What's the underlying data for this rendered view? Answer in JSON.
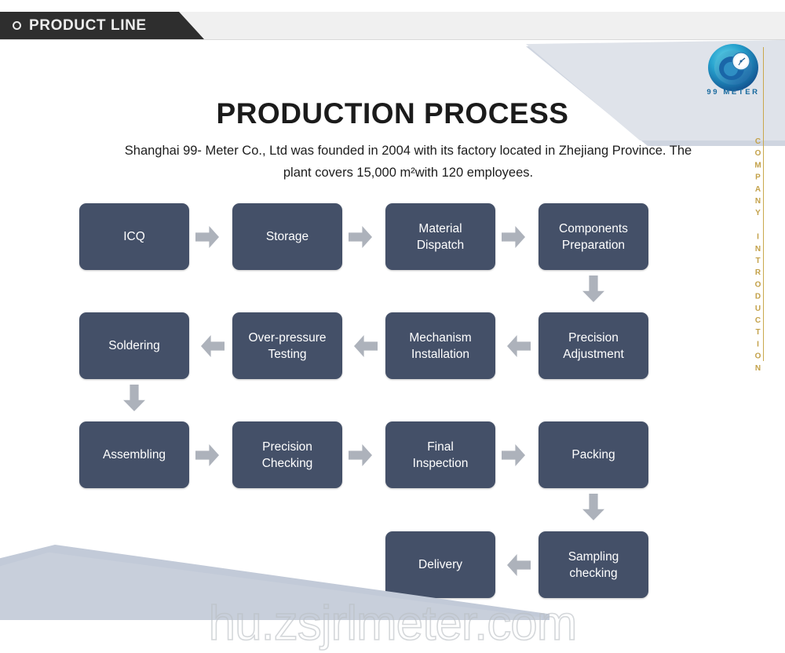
{
  "header": {
    "tag_label": "PRODUCT LINE",
    "bullet_icon": "circle-outline-icon",
    "band_color": "#f0f0f0",
    "tag_color": "#2e2e2e"
  },
  "brand": {
    "logo_icon": "99-meter-spiral-gauge-logo",
    "logo_text": "99 METER",
    "logo_color": "#17699e"
  },
  "side_rail": {
    "vertical_label": "COMPANY INTRODUCTION",
    "color": "#c3a149"
  },
  "main": {
    "title": "PRODUCTION PROCESS",
    "intro_line1": "Shanghai 99- Meter Co., Ltd was founded in 2004 with its factory located in Zhejiang",
    "intro_line2": "Province. The plant covers 15,000 m²with 120 employees."
  },
  "diagram": {
    "node_color": "#445068",
    "arrow_color": "#adb2bb",
    "nodes": [
      {
        "id": "icq",
        "label_l1": "ICQ",
        "label_l2": ""
      },
      {
        "id": "storage",
        "label_l1": "Storage",
        "label_l2": ""
      },
      {
        "id": "material-dispatch",
        "label_l1": "Material",
        "label_l2": "Dispatch"
      },
      {
        "id": "components-preparation",
        "label_l1": "Components",
        "label_l2": "Preparation"
      },
      {
        "id": "soldering",
        "label_l1": "Soldering",
        "label_l2": ""
      },
      {
        "id": "over-pressure-testing",
        "label_l1": "Over-pressure",
        "label_l2": "Testing"
      },
      {
        "id": "mechanism-installation",
        "label_l1": "Mechanism",
        "label_l2": "Installation"
      },
      {
        "id": "precision-adjustment",
        "label_l1": "Precision",
        "label_l2": "Adjustment"
      },
      {
        "id": "assembling",
        "label_l1": "Assembling",
        "label_l2": ""
      },
      {
        "id": "precision-checking",
        "label_l1": "Precision",
        "label_l2": "Checking"
      },
      {
        "id": "final-inspection",
        "label_l1": "Final",
        "label_l2": "Inspection"
      },
      {
        "id": "packing",
        "label_l1": "Packing",
        "label_l2": ""
      },
      {
        "id": "delivery",
        "label_l1": "Delivery",
        "label_l2": ""
      },
      {
        "id": "sampling-checking",
        "label_l1": "Sampling",
        "label_l2": "checking"
      }
    ]
  },
  "watermark": {
    "text": "hu.zsjrlmeter.com"
  }
}
